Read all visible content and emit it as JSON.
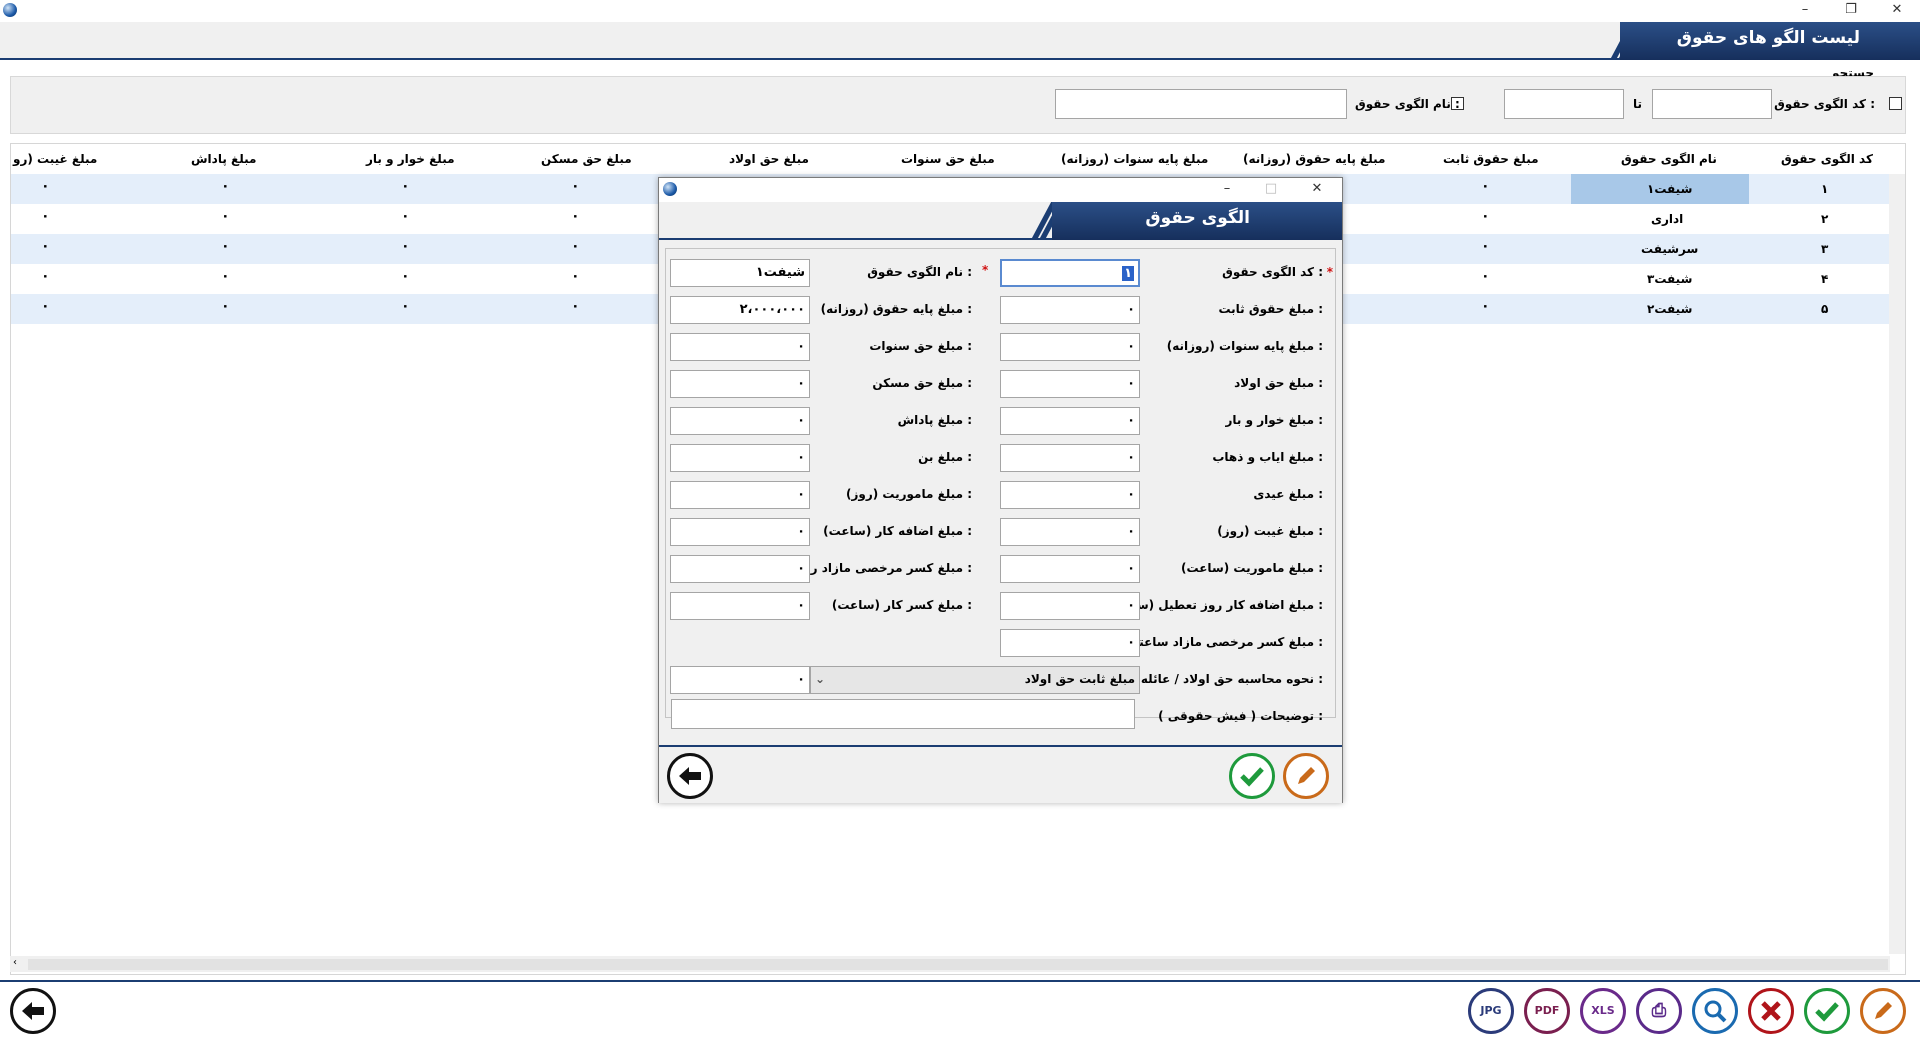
{
  "window": {
    "title": "",
    "buttons": {
      "minimize": "–",
      "maximize": "❐",
      "close": "✕"
    }
  },
  "header": {
    "title": "لیست الگو های حقوق"
  },
  "search": {
    "label": "جستجو",
    "code_from_label": "کد الگوی حقوق از :",
    "to_label": "تا",
    "name_label": "نام الگوی حقوق :",
    "code_from_value": "",
    "code_to_value": "",
    "name_value": ""
  },
  "grid": {
    "columns": [
      "کد الگوی حقوق",
      "نام الگوی حقوق",
      "مبلغ حقوق ثابت",
      "مبلغ پایه حقوق (روزانه)",
      "مبلغ پایه سنوات (روزانه)",
      "مبلغ حق سنوات",
      "مبلغ حق اولاد",
      "مبلغ حق مسکن",
      "مبلغ خوار و بار",
      "مبلغ پاداش",
      "مبلغ غیبت (رو"
    ],
    "rows": [
      {
        "code": "۱",
        "name": "شیفت۱",
        "v": "۰"
      },
      {
        "code": "۲",
        "name": "اداری",
        "v": "۰"
      },
      {
        "code": "۳",
        "name": "سرشیفت",
        "v": "۰"
      },
      {
        "code": "۴",
        "name": "شیفت۳",
        "v": "۰"
      },
      {
        "code": "۵",
        "name": "شیفت۲",
        "v": "۰"
      }
    ],
    "selected_row": 0
  },
  "bottom_toolbar": {
    "jpg": "JPG",
    "pdf": "PDF",
    "xls": "XLS"
  },
  "dialog": {
    "title": "الگوی حقوق",
    "required_mark": "*",
    "right_fields": [
      {
        "label": "کد الگوی حقوق :",
        "value": "۱"
      },
      {
        "label": "مبلغ حقوق ثابت :",
        "value": "۰"
      },
      {
        "label": "مبلغ پایه سنوات (روزانه) :",
        "value": "۰"
      },
      {
        "label": "مبلغ حق اولاد :",
        "value": "۰"
      },
      {
        "label": "مبلغ خوار و بار :",
        "value": "۰"
      },
      {
        "label": "مبلغ ایاب و ذهاب :",
        "value": "۰"
      },
      {
        "label": "مبلغ عیدی :",
        "value": "۰"
      },
      {
        "label": "مبلغ غیبت (روز) :",
        "value": "۰"
      },
      {
        "label": "مبلغ ماموریت (ساعت) :",
        "value": "۰"
      },
      {
        "label": "مبلغ اضافه کار   روز تعطیل (ساعت) :",
        "value": "۰"
      },
      {
        "label": "مبلغ کسر مرخصی مازاد ساعتی :",
        "value": "۰"
      }
    ],
    "left_fields": [
      {
        "label": "نام الگوی حقوق :",
        "value": "شیفت۱"
      },
      {
        "label": "مبلغ پایه حقوق (روزانه) :",
        "value": "۲،۰۰۰،۰۰۰"
      },
      {
        "label": "مبلغ حق سنوات :",
        "value": "۰"
      },
      {
        "label": "مبلغ حق مسکن :",
        "value": "۰"
      },
      {
        "label": "مبلغ پاداش :",
        "value": "۰"
      },
      {
        "label": "مبلغ بن :",
        "value": "۰"
      },
      {
        "label": "مبلغ ماموریت (روز) :",
        "value": "۰"
      },
      {
        "label": "مبلغ اضافه کار (ساعت) :",
        "value": "۰"
      },
      {
        "label": "مبلغ کسر مرخصی مازاد روزانه :",
        "value": "۰"
      },
      {
        "label": "مبلغ کسر کار (ساعت) :",
        "value": "۰"
      }
    ],
    "child_calc_label": "نحوه محاسبه حق اولاد / عائله :",
    "child_calc_selected": "مبلغ ثابت حق اولاد",
    "child_calc_amount": "۰",
    "notes_label": "توضیحات ( فیش حقوقی ) :",
    "notes_value": ""
  },
  "colors": {
    "header_blue": "#1b3d72",
    "alt_row": "#e4eefa",
    "selected_cell": "#a8c8e8",
    "ok_green": "#1e9a3c",
    "edit_orange": "#c96a1a",
    "cancel_red": "#b0141a"
  }
}
